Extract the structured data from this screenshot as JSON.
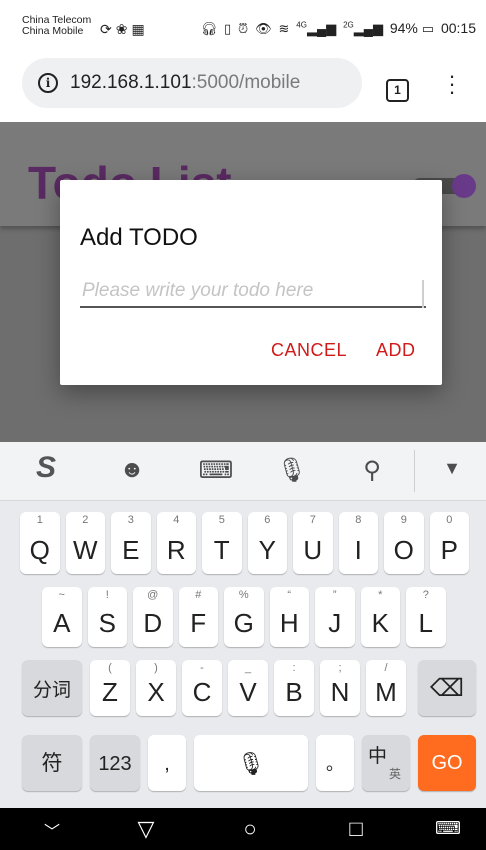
{
  "status_bar": {
    "carrier_1": "China Telecom",
    "carrier_2": "China Mobile",
    "battery": "94%",
    "time": "00:15",
    "network_1": "4G",
    "network_2": "2G"
  },
  "browser": {
    "url_host": "192.168.1.101",
    "url_port": ":5000/mobile",
    "tab_count": "1"
  },
  "page": {
    "title": "Todo List",
    "toggle_color": "#8e44ad"
  },
  "dialog": {
    "title": "Add TODO",
    "input_placeholder": "Please write your todo here",
    "input_value": "",
    "cancel_label": "CANCEL",
    "add_label": "ADD",
    "accent_color": "#d11a1a"
  },
  "keyboard": {
    "toolbar_icons": [
      "sogou-logo-icon",
      "emoji-icon",
      "keyboard-icon",
      "microphone-icon",
      "search-icon",
      "collapse-icon"
    ],
    "row1": [
      {
        "main": "Q",
        "sub": "1"
      },
      {
        "main": "W",
        "sub": "2"
      },
      {
        "main": "E",
        "sub": "3"
      },
      {
        "main": "R",
        "sub": "4"
      },
      {
        "main": "T",
        "sub": "5"
      },
      {
        "main": "Y",
        "sub": "6"
      },
      {
        "main": "U",
        "sub": "7"
      },
      {
        "main": "I",
        "sub": "8"
      },
      {
        "main": "O",
        "sub": "9"
      },
      {
        "main": "P",
        "sub": "0"
      }
    ],
    "row2": [
      {
        "main": "A",
        "sub": "~"
      },
      {
        "main": "S",
        "sub": "!"
      },
      {
        "main": "D",
        "sub": "@"
      },
      {
        "main": "F",
        "sub": "#"
      },
      {
        "main": "G",
        "sub": "%"
      },
      {
        "main": "H",
        "sub": "“"
      },
      {
        "main": "J",
        "sub": "”"
      },
      {
        "main": "K",
        "sub": "*"
      },
      {
        "main": "L",
        "sub": "?"
      }
    ],
    "row3": [
      {
        "main": "Z",
        "sub": "("
      },
      {
        "main": "X",
        "sub": ")"
      },
      {
        "main": "C",
        "sub": "-"
      },
      {
        "main": "V",
        "sub": "_"
      },
      {
        "main": "B",
        "sub": ":"
      },
      {
        "main": "N",
        "sub": ";"
      },
      {
        "main": "M",
        "sub": "/"
      }
    ],
    "fenci_label": "分词",
    "symbol_label": "符",
    "num_label": "123",
    "comma_label": ",",
    "period_label": "。",
    "lang_main": "中",
    "lang_sub": "英",
    "go_label": "GO",
    "go_color": "#ff6b1f"
  },
  "nav_bar": {
    "icons": [
      "chevron-down-icon",
      "back-triangle-icon",
      "home-circle-icon",
      "recents-square-icon",
      "keyboard-switch-icon"
    ]
  }
}
